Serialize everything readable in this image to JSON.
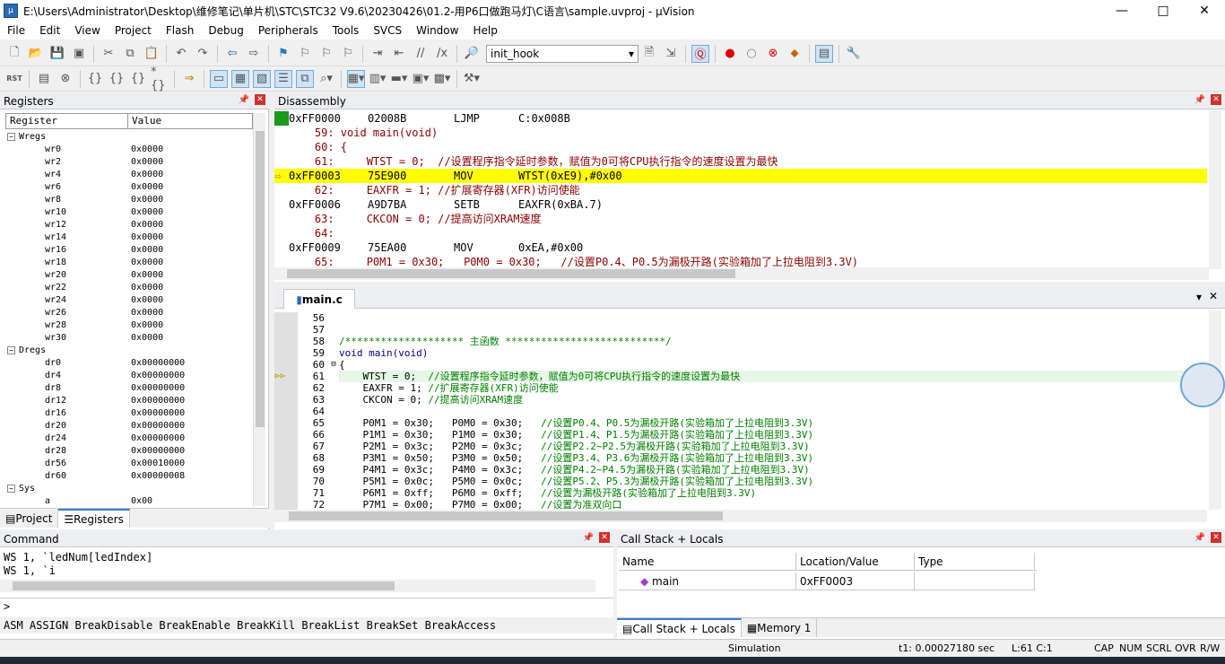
{
  "window": {
    "title": "E:\\Users\\Administrator\\Desktop\\维修笔记\\单片机\\STC\\STC32 V9.6\\20230426\\01.2-用P6口做跑马灯\\C语言\\sample.uvproj - µVision",
    "min": "—",
    "max": "□",
    "close": "✕"
  },
  "menu": [
    "File",
    "Edit",
    "View",
    "Project",
    "Flash",
    "Debug",
    "Peripherals",
    "Tools",
    "SVCS",
    "Window",
    "Help"
  ],
  "toolbar": {
    "combo_value": "init_hook",
    "rst_label": "RST"
  },
  "registers": {
    "title": "Registers",
    "col_register": "Register",
    "col_value": "Value",
    "rows": [
      {
        "kind": "grp",
        "name": "Wregs",
        "value": ""
      },
      {
        "kind": "itm",
        "name": "wr0",
        "value": "0x0000"
      },
      {
        "kind": "itm",
        "name": "wr2",
        "value": "0x0000"
      },
      {
        "kind": "itm",
        "name": "wr4",
        "value": "0x0000"
      },
      {
        "kind": "itm",
        "name": "wr6",
        "value": "0x0000"
      },
      {
        "kind": "itm",
        "name": "wr8",
        "value": "0x0000"
      },
      {
        "kind": "itm",
        "name": "wr10",
        "value": "0x0000"
      },
      {
        "kind": "itm",
        "name": "wr12",
        "value": "0x0000"
      },
      {
        "kind": "itm",
        "name": "wr14",
        "value": "0x0000"
      },
      {
        "kind": "itm",
        "name": "wr16",
        "value": "0x0000"
      },
      {
        "kind": "itm",
        "name": "wr18",
        "value": "0x0000"
      },
      {
        "kind": "itm",
        "name": "wr20",
        "value": "0x0000"
      },
      {
        "kind": "itm",
        "name": "wr22",
        "value": "0x0000"
      },
      {
        "kind": "itm",
        "name": "wr24",
        "value": "0x0000"
      },
      {
        "kind": "itm",
        "name": "wr26",
        "value": "0x0000"
      },
      {
        "kind": "itm",
        "name": "wr28",
        "value": "0x0000"
      },
      {
        "kind": "itm",
        "name": "wr30",
        "value": "0x0000"
      },
      {
        "kind": "grp",
        "name": "Dregs",
        "value": ""
      },
      {
        "kind": "itm",
        "name": "dr0",
        "value": "0x00000000"
      },
      {
        "kind": "itm",
        "name": "dr4",
        "value": "0x00000000"
      },
      {
        "kind": "itm",
        "name": "dr8",
        "value": "0x00000000"
      },
      {
        "kind": "itm",
        "name": "dr12",
        "value": "0x00000000"
      },
      {
        "kind": "itm",
        "name": "dr16",
        "value": "0x00000000"
      },
      {
        "kind": "itm",
        "name": "dr20",
        "value": "0x00000000"
      },
      {
        "kind": "itm",
        "name": "dr24",
        "value": "0x00000000"
      },
      {
        "kind": "itm",
        "name": "dr28",
        "value": "0x00000000"
      },
      {
        "kind": "itm",
        "name": "dr56",
        "value": "0x00010000"
      },
      {
        "kind": "itm",
        "name": "dr60",
        "value": "0x00000008"
      },
      {
        "kind": "grp",
        "name": "Sys",
        "value": ""
      },
      {
        "kind": "itm",
        "name": "a",
        "value": "0x00"
      }
    ],
    "tabs": [
      "Project",
      "Registers"
    ]
  },
  "disassembly": {
    "title": "Disassembly",
    "rows": [
      {
        "type": "asm",
        "addr": "0xFF0000",
        "op": "02008B",
        "mn": "LJMP",
        "arg": "C:0x008B"
      },
      {
        "type": "src",
        "text": "    59: void main(void)"
      },
      {
        "type": "src",
        "text": "    60: {"
      },
      {
        "type": "src",
        "text": "    61:     WTST = 0;  //设置程序指令延时参数，赋值为0可将CPU执行指令的速度设置为最快"
      },
      {
        "type": "cur",
        "addr": "0xFF0003",
        "op": "75E900",
        "mn": "MOV",
        "arg": "WTST(0xE9),#0x00"
      },
      {
        "type": "src",
        "text": "    62:     EAXFR = 1; //扩展寄存器(XFR)访问使能"
      },
      {
        "type": "asm",
        "addr": "0xFF0006",
        "op": "A9D7BA",
        "mn": "SETB",
        "arg": "EAXFR(0xBA.7)"
      },
      {
        "type": "src",
        "text": "    63:     CKCON = 0; //提高访问XRAM速度"
      },
      {
        "type": "src",
        "text": "    64:"
      },
      {
        "type": "asm",
        "addr": "0xFF0009",
        "op": "75EA00",
        "mn": "MOV",
        "arg": "0xEA,#0x00"
      },
      {
        "type": "src",
        "text": "    65:     P0M1 = 0x30;   P0M0 = 0x30;   //设置P0.4、P0.5为漏极开路(实验箱加了上拉电阻到3.3V)"
      }
    ]
  },
  "editor": {
    "tab": "main.c",
    "lines": [
      {
        "n": "56",
        "t": ""
      },
      {
        "n": "57",
        "t": ""
      },
      {
        "n": "58",
        "t": "/******************** 主函数 ***************************/"
      },
      {
        "n": "59",
        "t": "void main(void)"
      },
      {
        "n": "60",
        "t": "{"
      },
      {
        "n": "61",
        "t": "    WTST = 0;  //设置程序指令延时参数，赋值为0可将CPU执行指令的速度设置为最快"
      },
      {
        "n": "62",
        "t": "    EAXFR = 1; //扩展寄存器(XFR)访问使能"
      },
      {
        "n": "63",
        "t": "    CKCON = 0; //提高访问XRAM速度"
      },
      {
        "n": "64",
        "t": ""
      },
      {
        "n": "65",
        "t": "    P0M1 = 0x30;   P0M0 = 0x30;   //设置P0.4、P0.5为漏极开路(实验箱加了上拉电阻到3.3V)"
      },
      {
        "n": "66",
        "t": "    P1M1 = 0x30;   P1M0 = 0x30;   //设置P1.4、P1.5为漏极开路(实验箱加了上拉电阻到3.3V)"
      },
      {
        "n": "67",
        "t": "    P2M1 = 0x3c;   P2M0 = 0x3c;   //设置P2.2~P2.5为漏极开路(实验箱加了上拉电阻到3.3V)"
      },
      {
        "n": "68",
        "t": "    P3M1 = 0x50;   P3M0 = 0x50;   //设置P3.4、P3.6为漏极开路(实验箱加了上拉电阻到3.3V)"
      },
      {
        "n": "69",
        "t": "    P4M1 = 0x3c;   P4M0 = 0x3c;   //设置P4.2~P4.5为漏极开路(实验箱加了上拉电阻到3.3V)"
      },
      {
        "n": "70",
        "t": "    P5M1 = 0x0c;   P5M0 = 0x0c;   //设置P5.2、P5.3为漏极开路(实验箱加了上拉电阻到3.3V)"
      },
      {
        "n": "71",
        "t": "    P6M1 = 0xff;   P6M0 = 0xff;   //设置为漏极开路(实验箱加了上拉电阻到3.3V)"
      },
      {
        "n": "72",
        "t": "    P7M1 = 0x00;   P7M0 = 0x00;   //设置为准双向口"
      }
    ]
  },
  "command": {
    "title": "Command",
    "lines": [
      "WS 1, `ledNum[ledIndex]",
      "WS 1, `i"
    ],
    "prompt": ">",
    "help": "ASM ASSIGN BreakDisable BreakEnable BreakKill BreakList BreakSet BreakAccess"
  },
  "callstack": {
    "title": "Call Stack + Locals",
    "col_name": "Name",
    "col_location": "Location/Value",
    "col_type": "Type",
    "row_name": "main",
    "row_location": "0xFF0003",
    "row_type": "",
    "tabs": [
      "Call Stack + Locals",
      "Memory 1"
    ]
  },
  "status": {
    "mode": "Simulation",
    "time": "t1: 0.00027180 sec",
    "pos": "L:61 C:1",
    "caps": "CAP",
    "num": "NUM",
    "scrl": "SCRL",
    "ovr": "OVR",
    "rw": "R/W"
  },
  "colors": {
    "exec_line": "#ffff00",
    "comment": "#008000",
    "keyword": "#00008b"
  }
}
